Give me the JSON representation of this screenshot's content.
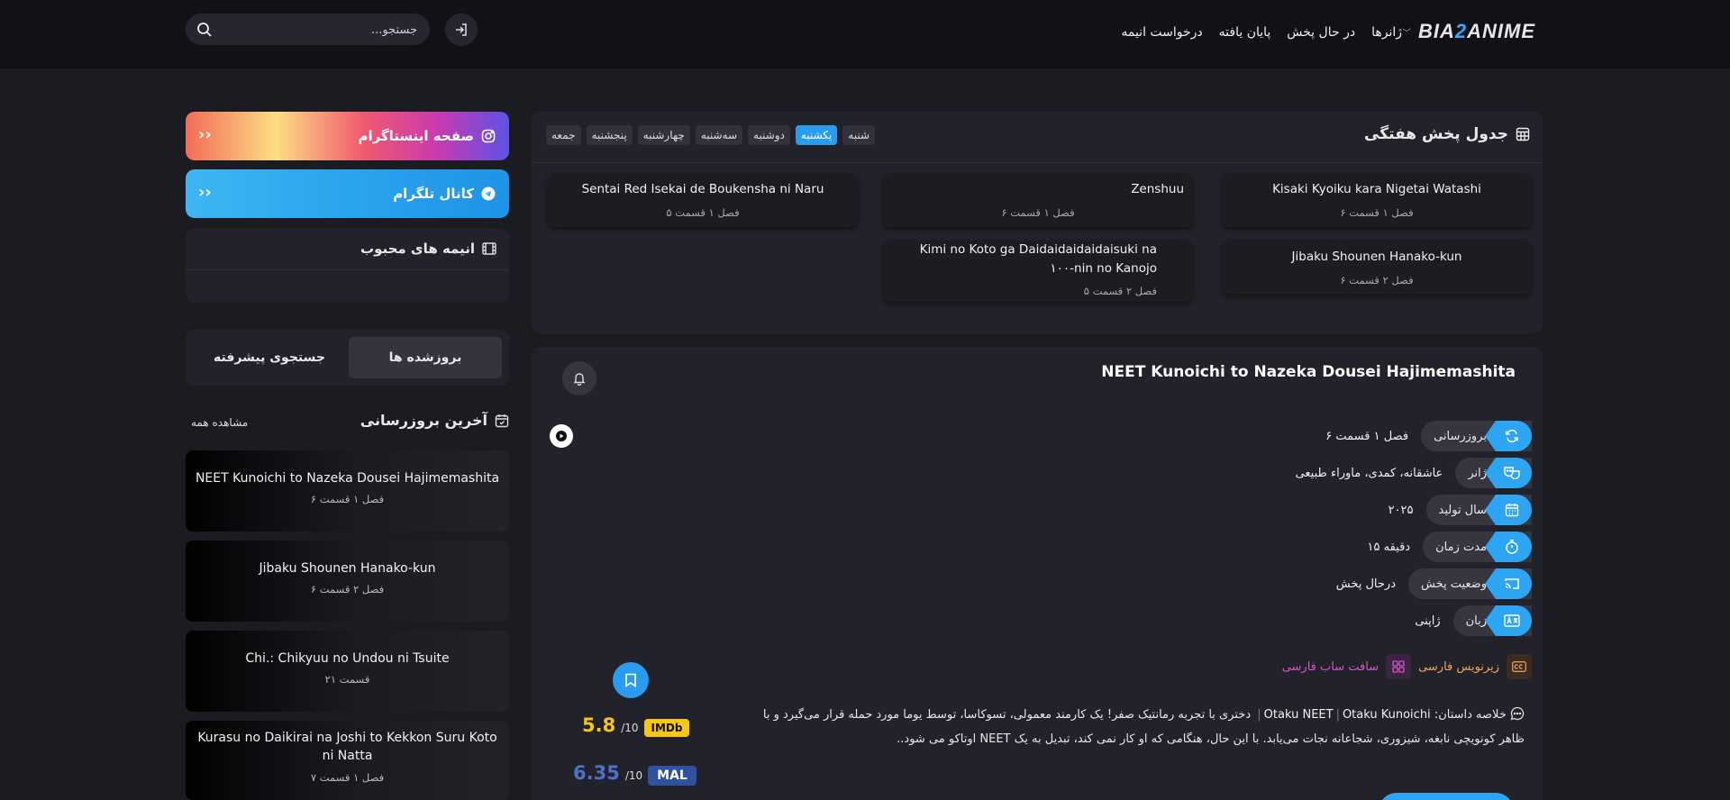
{
  "header": {
    "logo_pre": "BIA",
    "logo_hl": "2",
    "logo_post": "ANIME",
    "nav": {
      "genres": "ژانرها",
      "airing": "در حال پخش",
      "finished": "پایان یافته",
      "request": "درخواست انیمه"
    },
    "search_placeholder": "جستجو..."
  },
  "schedule": {
    "title": "جدول پخش هفتگی",
    "days": [
      "شنبه",
      "یکشنبه",
      "دوشنبه",
      "سه‌شنبه",
      "چهارشنبه",
      "پنجشنبه",
      "جمعه"
    ],
    "active_day": "یکشنبه",
    "items": [
      {
        "title": "Kisaki Kyoiku kara Nigetai Watashi",
        "ep": "فصل ۱ قسمت ۶"
      },
      {
        "title": "Zenshuu",
        "ep": "فصل ۱ قسمت ۶"
      },
      {
        "title": "Sentai Red Isekai de Boukensha ni Naru",
        "ep": "فصل ۱ قسمت ۵"
      },
      {
        "title": "Jibaku Shounen Hanako-kun",
        "ep": "فصل ۲ قسمت ۶"
      },
      {
        "title": "Kimi no Koto ga Daidaidaidaidaisuki na ۱۰۰-nin no Kanojo",
        "ep": "فصل ۲ قسمت ۵"
      }
    ]
  },
  "sidebar": {
    "instagram": "صفحه اینستاگرام",
    "telegram": "کانال تلگرام",
    "favorites": "انیمه های محبوب",
    "tabs": {
      "updated": "بروزشده ها",
      "advanced": "جستجوی پیشرفته"
    },
    "latest_title": "آخرین بروزرسانی",
    "see_all": "مشاهده همه",
    "latest": [
      {
        "title": "NEET Kunoichi to Nazeka Dousei Hajimemashita",
        "ep": "فصل ۱ قسمت ۶"
      },
      {
        "title": "Jibaku Shounen Hanako-kun",
        "ep": "فصل ۲ قسمت ۶"
      },
      {
        "title": "Chi.: Chikyuu no Undou ni Tsuite",
        "ep": "قسمت ۲۱"
      },
      {
        "title": "Kurasu no Daikirai na Joshi to Kekkon Suru Koto ni Natta",
        "ep": "فصل ۱ قسمت ۷"
      }
    ]
  },
  "detail": {
    "title": "NEET Kunoichi to Nazeka Dousei Hajimemashita",
    "info": [
      {
        "label": "بروزرسانی",
        "value": "فصل ۱ قسمت ۶",
        "icon": "refresh-icon"
      },
      {
        "label": "ژانر",
        "value": "عاشقانه، کمدی، ماوراء طبیعی",
        "icon": "masks-icon"
      },
      {
        "label": "سال تولید",
        "value": "۲۰۲۵",
        "icon": "calendar-icon"
      },
      {
        "label": "مدت زمان",
        "value": "۱۵ دقیقه",
        "icon": "stopwatch-icon"
      },
      {
        "label": "وضعیت پخش",
        "value": "درحال پخش",
        "icon": "cast-icon"
      },
      {
        "label": "زبان",
        "value": "ژاپنی",
        "icon": "language-icon"
      }
    ],
    "subtitle_label": "زیرنویس فارسی",
    "softsub_label": "سافت ساب فارسی",
    "summary_label": "خلاصه داستان:",
    "alt_names": [
      "Otaku NEET",
      "Otaku Kunoichi"
    ],
    "summary": "دختری با تجربه رمانتیک صفر! یک کارمند معمولی، تسوکاسا، توسط یوما مورد حمله قرار می‌گیرد و با ظاهر کونویچی نابغه، شیزوری، شجاعانه نجات می‌یابد. با این حال، هنگامی که او کار نمی کند، تبدیل به یک NEET اوتاکو می شود..",
    "imdb": {
      "badge": "IMDb",
      "score": "5.8",
      "den": "/10"
    },
    "mal": {
      "badge": "MAL",
      "score": "6.35",
      "den": "/10"
    }
  }
}
